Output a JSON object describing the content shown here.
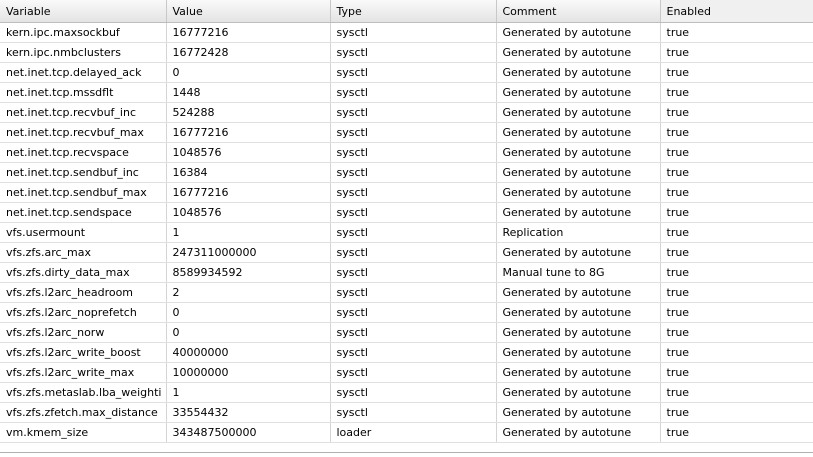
{
  "columns": [
    "Variable",
    "Value",
    "Type",
    "Comment",
    "Enabled"
  ],
  "rows": [
    [
      "kern.ipc.maxsockbuf",
      "16777216",
      "sysctl",
      "Generated by autotune",
      "true"
    ],
    [
      "kern.ipc.nmbclusters",
      "16772428",
      "sysctl",
      "Generated by autotune",
      "true"
    ],
    [
      "net.inet.tcp.delayed_ack",
      "0",
      "sysctl",
      "Generated by autotune",
      "true"
    ],
    [
      "net.inet.tcp.mssdflt",
      "1448",
      "sysctl",
      "Generated by autotune",
      "true"
    ],
    [
      "net.inet.tcp.recvbuf_inc",
      "524288",
      "sysctl",
      "Generated by autotune",
      "true"
    ],
    [
      "net.inet.tcp.recvbuf_max",
      "16777216",
      "sysctl",
      "Generated by autotune",
      "true"
    ],
    [
      "net.inet.tcp.recvspace",
      "1048576",
      "sysctl",
      "Generated by autotune",
      "true"
    ],
    [
      "net.inet.tcp.sendbuf_inc",
      "16384",
      "sysctl",
      "Generated by autotune",
      "true"
    ],
    [
      "net.inet.tcp.sendbuf_max",
      "16777216",
      "sysctl",
      "Generated by autotune",
      "true"
    ],
    [
      "net.inet.tcp.sendspace",
      "1048576",
      "sysctl",
      "Generated by autotune",
      "true"
    ],
    [
      "vfs.usermount",
      "1",
      "sysctl",
      "Replication",
      "true"
    ],
    [
      "vfs.zfs.arc_max",
      "247311000000",
      "sysctl",
      "Generated by autotune",
      "true"
    ],
    [
      "vfs.zfs.dirty_data_max",
      "8589934592",
      "sysctl",
      "Manual tune to 8G",
      "true"
    ],
    [
      "vfs.zfs.l2arc_headroom",
      "2",
      "sysctl",
      "Generated by autotune",
      "true"
    ],
    [
      "vfs.zfs.l2arc_noprefetch",
      "0",
      "sysctl",
      "Generated by autotune",
      "true"
    ],
    [
      "vfs.zfs.l2arc_norw",
      "0",
      "sysctl",
      "Generated by autotune",
      "true"
    ],
    [
      "vfs.zfs.l2arc_write_boost",
      "40000000",
      "sysctl",
      "Generated by autotune",
      "true"
    ],
    [
      "vfs.zfs.l2arc_write_max",
      "10000000",
      "sysctl",
      "Generated by autotune",
      "true"
    ],
    [
      "vfs.zfs.metaslab.lba_weighti",
      "1",
      "sysctl",
      "Generated by autotune",
      "true"
    ],
    [
      "vfs.zfs.zfetch.max_distance",
      "33554432",
      "sysctl",
      "Generated by autotune",
      "true"
    ],
    [
      "vm.kmem_size",
      "343487500000",
      "loader",
      "Generated by autotune",
      "true"
    ]
  ]
}
